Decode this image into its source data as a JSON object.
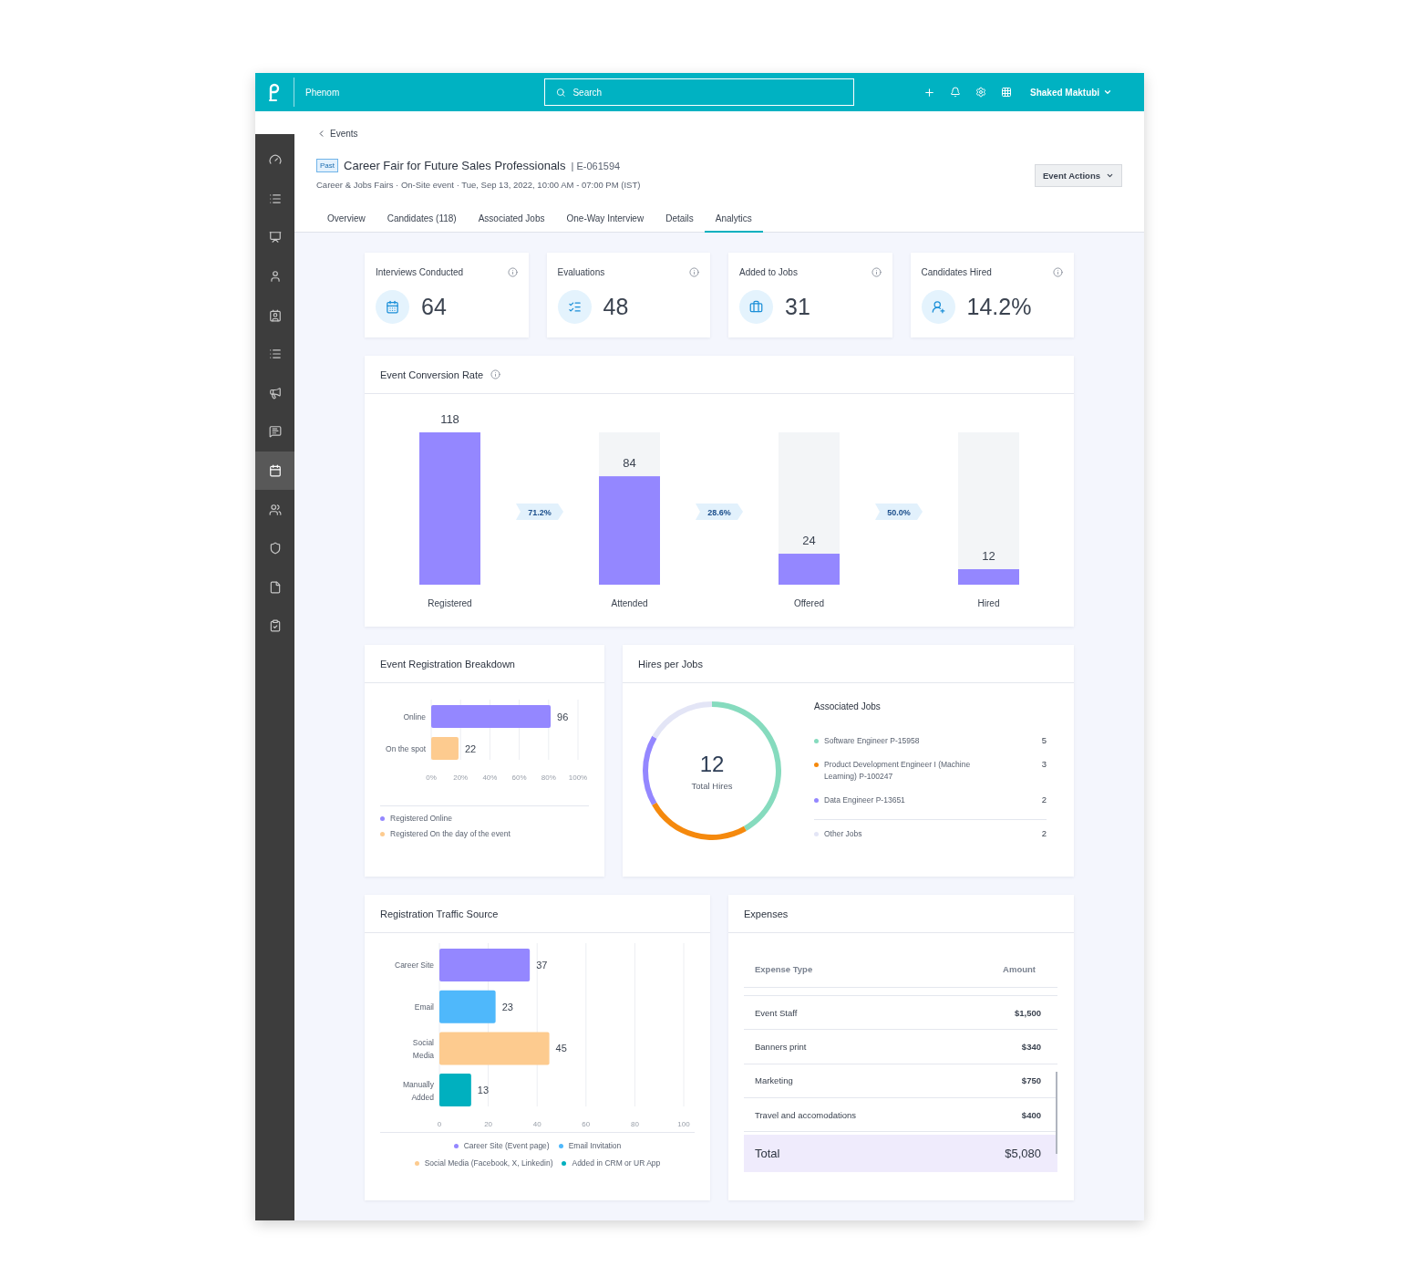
{
  "header": {
    "brand": "Phenom",
    "search": {
      "placeholder": "Search"
    },
    "user": "Shaked Maktubi"
  },
  "sidebar": {
    "items": [
      {
        "selected": false
      },
      {
        "selected": false
      },
      {
        "selected": false
      },
      {
        "selected": false
      },
      {
        "selected": false
      },
      {
        "selected": false
      },
      {
        "selected": false
      },
      {
        "selected": false
      },
      {
        "selected": true
      },
      {
        "selected": false
      },
      {
        "selected": false
      },
      {
        "selected": false
      },
      {
        "selected": false
      }
    ]
  },
  "breadcrumb": "Events",
  "event": {
    "status": "Past",
    "title": "Career Fair for Future Sales Professionals",
    "id": "| E-061594",
    "meta": "Career & Jobs Fairs · On-Site event · Tue, Sep 13, 2022, 10:00 AM - 07:00 PM (IST)",
    "actions": "Event Actions"
  },
  "tabs": [
    {
      "label": "Overview",
      "selected": false
    },
    {
      "label": "Candidates (118)",
      "selected": false
    },
    {
      "label": "Associated Jobs",
      "selected": false
    },
    {
      "label": "One-Way Interview",
      "selected": false
    },
    {
      "label": "Details",
      "selected": false
    },
    {
      "label": "Analytics",
      "selected": true
    }
  ],
  "stats": [
    {
      "label": "Interviews Conducted",
      "value": "64"
    },
    {
      "label": "Evaluations",
      "value": "48"
    },
    {
      "label": "Added to Jobs",
      "value": "31"
    },
    {
      "label": "Candidates Hired",
      "value": "14.2%"
    }
  ],
  "conversion": {
    "title": "Event Conversion Rate",
    "rates": [
      "71.2%",
      "28.6%",
      "50.0%"
    ],
    "chart_data": {
      "type": "bar",
      "categories": [
        "Registered",
        "Attended",
        "Offered",
        "Hired"
      ],
      "values": [
        118,
        84,
        24,
        12
      ],
      "data_labels": true
    }
  },
  "breakdown": {
    "title": "Event Registration Breakdown",
    "chart_data": {
      "type": "bar",
      "orientation": "horizontal",
      "stacked": true,
      "grid": true,
      "value_labels": [
        "96",
        "22"
      ],
      "categories": [
        "Online",
        "On the spot"
      ],
      "xlim": [
        0,
        100
      ],
      "xticks": [
        {
          "value": 0,
          "label": "0%"
        },
        {
          "value": 20,
          "label": "20%"
        },
        {
          "value": 40,
          "label": "40%"
        },
        {
          "value": 60,
          "label": "60%"
        },
        {
          "value": 80,
          "label": "80%"
        },
        {
          "value": 100,
          "label": "100%"
        }
      ],
      "series": [
        {
          "name": "Registered Online",
          "color": "#9487ff",
          "values": [
            81.4,
            null
          ]
        },
        {
          "name": "Registered On the day of the event",
          "color": "#fdcb8f",
          "values": [
            null,
            18.6
          ]
        }
      ]
    }
  },
  "hires": {
    "title": "Hires per Jobs",
    "total": "12",
    "total_label": "Total Hires",
    "legend_title": "Associated Jobs",
    "jobs": [
      {
        "count": "5",
        "color": "#86dbbe",
        "kind": "job"
      },
      {
        "count": "3",
        "color": "#f5890d",
        "kind": "job"
      },
      {
        "count": "2",
        "color": "#9487ff",
        "kind": "job"
      },
      {
        "count": "2",
        "color": "#e3e5f6",
        "kind": "other"
      }
    ],
    "chart_data": {
      "type": "donut",
      "categories": [
        "Software Engineer P-15958",
        "Product Development Engineer I (Machine Learning) P-100247",
        "Data Engineer P-13651",
        "Other Jobs"
      ],
      "values": [
        41.7,
        25,
        16.7,
        16.6
      ]
    }
  },
  "traffic": {
    "title": "Registration Traffic Source",
    "chart_data": {
      "type": "bar",
      "orientation": "horizontal",
      "stacked": true,
      "grid": true,
      "data_labels": true,
      "categories": [
        "Career Site",
        "Email",
        "Social Media",
        "Manually Added"
      ],
      "xlim": [
        0,
        100
      ],
      "xticks": [
        0,
        20,
        40,
        60,
        80,
        100
      ],
      "series": [
        {
          "name": "Career Site (Event page)",
          "color": "#9487ff",
          "values": [
            37,
            null,
            null,
            null
          ]
        },
        {
          "name": "Email Invitation",
          "color": "#4fb8fb",
          "values": [
            null,
            23,
            null,
            null
          ]
        },
        {
          "name": "Social Media (Facebook, X, Linkedin)",
          "color": "#fdcb8f",
          "values": [
            null,
            null,
            45,
            null
          ]
        },
        {
          "name": "Added in CRM or UR App",
          "color": "#00b0bf",
          "values": [
            null,
            null,
            null,
            13
          ]
        }
      ]
    }
  },
  "expenses": {
    "title": "Expenses",
    "columns": [
      "Expense Type",
      "Amount"
    ],
    "rows": [
      [
        "Event Staff",
        "$1,500"
      ],
      [
        "Banners print",
        "$340"
      ],
      [
        "Marketing",
        "$750"
      ],
      [
        "Travel and accomodations",
        "$400"
      ]
    ],
    "total": {
      "label": "Total",
      "amount": "$5,080"
    }
  }
}
